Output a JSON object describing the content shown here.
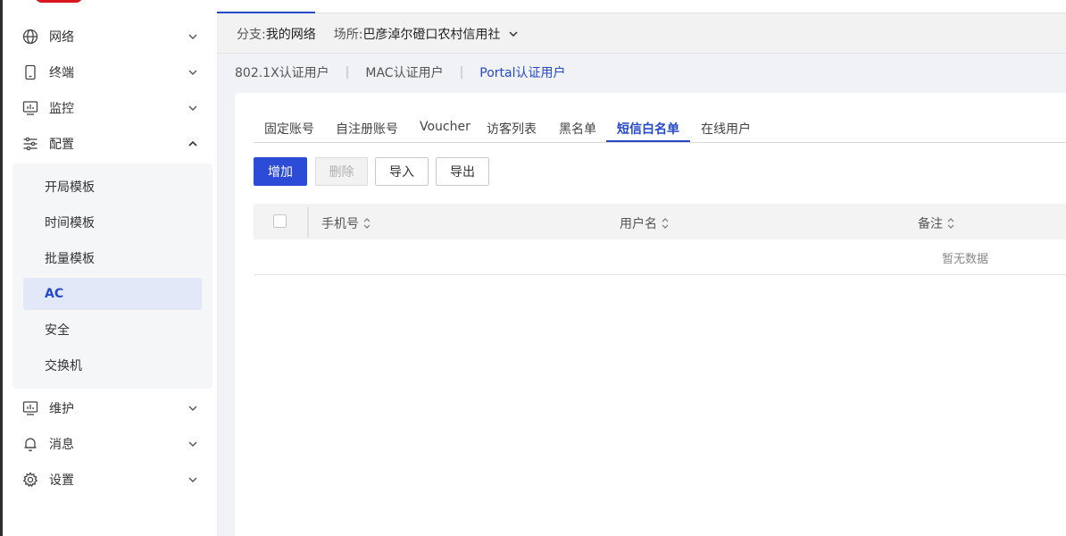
{
  "sidebar": {
    "items": [
      {
        "label": "网络",
        "icon": "globe-icon"
      },
      {
        "label": "终端",
        "icon": "phone-icon"
      },
      {
        "label": "监控",
        "icon": "monitor-chart-icon"
      },
      {
        "label": "配置",
        "icon": "sliders-icon",
        "expanded": true
      },
      {
        "label": "维护",
        "icon": "monitor-chart-icon"
      },
      {
        "label": "消息",
        "icon": "bell-icon"
      },
      {
        "label": "设置",
        "icon": "gear-icon"
      }
    ],
    "config_sub": [
      "开局模板",
      "时间模板",
      "批量模板",
      "AC",
      "安全",
      "交换机"
    ],
    "active_sub": "AC"
  },
  "location_bar": {
    "branch_label": "分支:",
    "branch_value": "我的网络",
    "site_label": "场所:",
    "site_value": "巴彦淖尔磴口农村信用社"
  },
  "auth_tabs": [
    "802.1X认证用户",
    "MAC认证用户",
    "Portal认证用户"
  ],
  "auth_active": "Portal认证用户",
  "sub_tabs": [
    "固定账号",
    "自注册账号",
    "Voucher",
    "访客列表",
    "黑名单",
    "短信白名单",
    "在线用户"
  ],
  "sub_active": "短信白名单",
  "toolbar": {
    "add_label": "增加",
    "delete_label": "删除",
    "import_label": "导入",
    "export_label": "导出"
  },
  "table": {
    "columns": [
      "手机号",
      "用户名",
      "备注"
    ],
    "empty_text": "暂无数据"
  },
  "colors": {
    "accent": "#2449c9",
    "primary_button": "#2c4bd6",
    "brand": "#d9161d"
  }
}
